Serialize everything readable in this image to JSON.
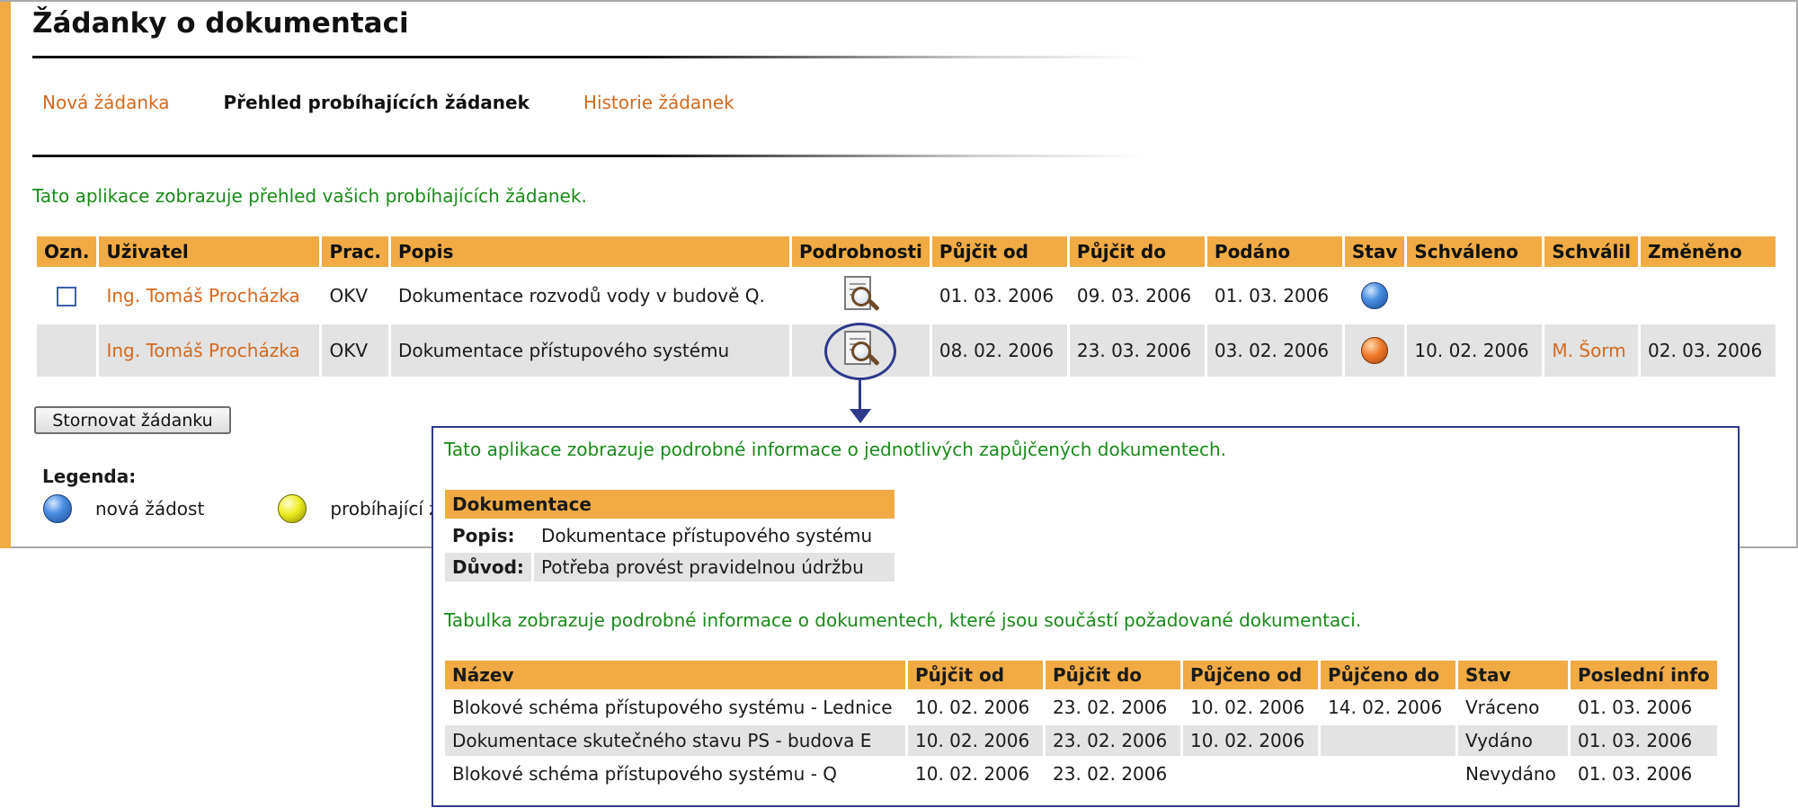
{
  "page": {
    "title": "Žádanky o dokumentaci"
  },
  "tabs": [
    {
      "label": "Nová žádanka"
    },
    {
      "label": "Přehled probíhajících žádanek"
    },
    {
      "label": "Historie žádanek"
    }
  ],
  "intro": "Tato aplikace zobrazuje přehled vašich probíhajících žádanek.",
  "table": {
    "headers": [
      "Ozn.",
      "Uživatel",
      "Prac.",
      "Popis",
      "Podrobnosti",
      "Půjčit od",
      "Půjčit do",
      "Podáno",
      "Stav",
      "Schváleno",
      "Schválil",
      "Změněno"
    ],
    "rows": [
      {
        "user": "Ing. Tomáš Procházka",
        "prac": "OKV",
        "popis": "Dokumentace rozvodů vody v budově Q.",
        "pujcit_od": "01. 03. 2006",
        "pujcit_do": "09. 03. 2006",
        "podano": "01. 03. 2006",
        "stav": "blue",
        "schvaleno": "",
        "schvalil": "",
        "zmeneno": ""
      },
      {
        "user": "Ing. Tomáš Procházka",
        "prac": "OKV",
        "popis": "Dokumentace přístupového systému",
        "pujcit_od": "08. 02. 2006",
        "pujcit_do": "23. 03. 2006",
        "podano": "03. 02. 2006",
        "stav": "orange",
        "schvaleno": "10. 02. 2006",
        "schvalil": "M. Šorm",
        "zmeneno": "02. 03. 2006"
      }
    ]
  },
  "cancel_button": "Stornovat žádanku",
  "legend": {
    "title": "Legenda:",
    "items": [
      {
        "color": "blue",
        "label": "nová žádost"
      },
      {
        "color": "yellow",
        "label": "probíhající ž"
      }
    ]
  },
  "popup": {
    "intro": "Tato aplikace zobrazuje podrobné informace o jednotlivých zapůjčených dokumentech.",
    "section_title": "Dokumentace",
    "fields": [
      {
        "key": "Popis:",
        "value": "Dokumentace přístupového systému"
      },
      {
        "key": "Důvod:",
        "value": "Potřeba provést pravidelnou údržbu"
      }
    ],
    "intro2": "Tabulka zobrazuje podrobné informace o dokumentech, které jsou součástí požadované dokumentaci.",
    "docs_headers": [
      "Název",
      "Půjčit od",
      "Půjčit do",
      "Půjčeno od",
      "Půjčeno do",
      "Stav",
      "Poslední info"
    ],
    "docs": [
      [
        "Blokové schéma přístupového systému - Lednice",
        "10. 02. 2006",
        "23. 02. 2006",
        "10. 02. 2006",
        "14. 02. 2006",
        "Vráceno",
        "01. 03. 2006"
      ],
      [
        "Dokumentace skutečného stavu PS - budova E",
        "10. 02. 2006",
        "23. 02. 2006",
        "10. 02. 2006",
        "",
        "Vydáno",
        "01. 03. 2006"
      ],
      [
        "Blokové schéma přístupového systému - Q",
        "10. 02. 2006",
        "23. 02. 2006",
        "",
        "",
        "Nevydáno",
        "01. 03. 2006"
      ]
    ]
  },
  "colors": {
    "accent": "#f0ab45",
    "link": "#d2691e",
    "info_text": "#1a8a1a",
    "popup_border": "#2e3a8c"
  }
}
